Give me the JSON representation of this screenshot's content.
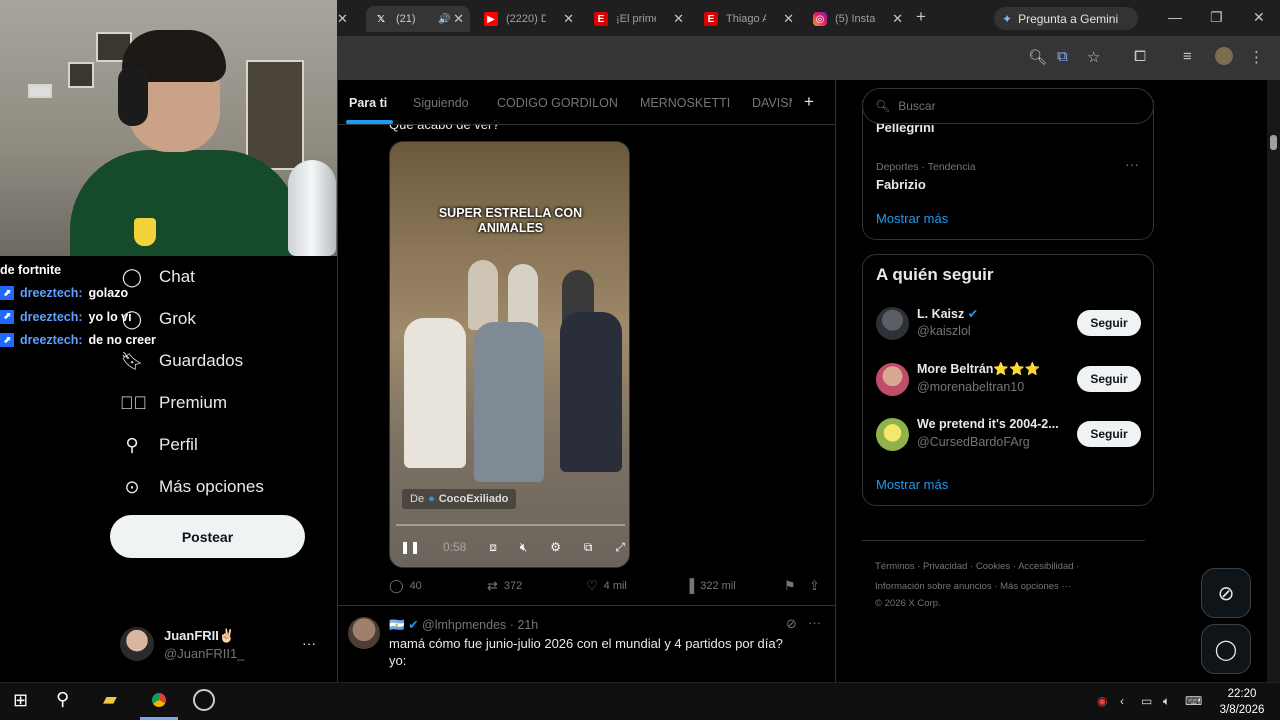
{
  "browser": {
    "tabs": [
      {
        "title": "",
        "icon": "x-icon"
      },
      {
        "title": "(21)",
        "icon": "x-logo",
        "active": true
      },
      {
        "title": "(2220) D",
        "icon": "youtube-icon"
      },
      {
        "title": "¡El prime",
        "icon": "espn-icon"
      },
      {
        "title": "Thiago A",
        "icon": "espn-icon"
      },
      {
        "title": "(5) Insta",
        "icon": "instagram-icon"
      }
    ],
    "gemini_label": "Pregunta a Gemini"
  },
  "stream_chat": [
    {
      "user": "",
      "message": "de fortnite"
    },
    {
      "user": "dreeztech:",
      "message": "golazo"
    },
    {
      "user": "dreeztech:",
      "message": "yo lo vi"
    },
    {
      "user": "dreeztech:",
      "message": "de no creer"
    }
  ],
  "nav": {
    "items": [
      {
        "label": "Chat",
        "icon": "chat-icon"
      },
      {
        "label": "Grok",
        "icon": "grok-icon"
      },
      {
        "label": "Guardados",
        "icon": "bookmark-icon"
      },
      {
        "label": "Premium",
        "icon": "premium-icon"
      },
      {
        "label": "Perfil",
        "icon": "person-icon"
      },
      {
        "label": "Más opciones",
        "icon": "more-circle-icon"
      }
    ],
    "post_label": "Postear",
    "account": {
      "name": "JuanFRII✌🏻",
      "handle": "@JuanFRII1_",
      "more": "···"
    }
  },
  "feed": {
    "tabs": [
      "Para ti",
      "Siguiendo",
      "CODIGO GORDILON",
      "MERNOSKETTI",
      "DAVISM"
    ],
    "active_tab": "Para ti",
    "tweet1": {
      "partial_text": "Qué acabo de ver?",
      "video_caption_line1": "SUPER ESTRELLA CON",
      "video_caption_line2": "ANIMALES",
      "video_from_prefix": "De",
      "video_from_user": "CocoExiliado",
      "video_time": "0:58",
      "actions": {
        "replies": "40",
        "reposts": "372",
        "likes": "4 mil",
        "views": "322 mil"
      }
    },
    "tweet2": {
      "flag": "🇦🇷",
      "handle": "@lmhpmendes",
      "time": "21h",
      "text_line1": "mamá cómo fue junio-julio 2026 con el mundial y 4 partidos por día?",
      "text_line2": "yo:"
    }
  },
  "sidebar": {
    "search_placeholder": "Buscar",
    "trend_partial": "Pellegrini",
    "trend": {
      "category": "Deportes · Tendencia",
      "name": "Fabrizio"
    },
    "trends_show_more": "Mostrar más",
    "who_to_follow_title": "A quién seguir",
    "follow": [
      {
        "name": "L. Kaisz",
        "handle": "@kaiszlol",
        "button": "Seguir",
        "verified": true
      },
      {
        "name": "More Beltrán⭐⭐⭐",
        "handle": "@morenabeltran10",
        "button": "Seguir",
        "verified": false
      },
      {
        "name": "We pretend it's 2004-2...",
        "handle": "@CursedBardoFArg",
        "button": "Seguir",
        "verified": false
      }
    ],
    "follow_show_more": "Mostrar más",
    "footer_line1": "Términos · Privacidad · Cookies · Accesibilidad ·",
    "footer_line2": "Información sobre anuncios · Más opciones ···",
    "footer_line3": "© 2026 X Corp."
  },
  "taskbar": {
    "time": "22:20",
    "date": "3/8/2026"
  }
}
